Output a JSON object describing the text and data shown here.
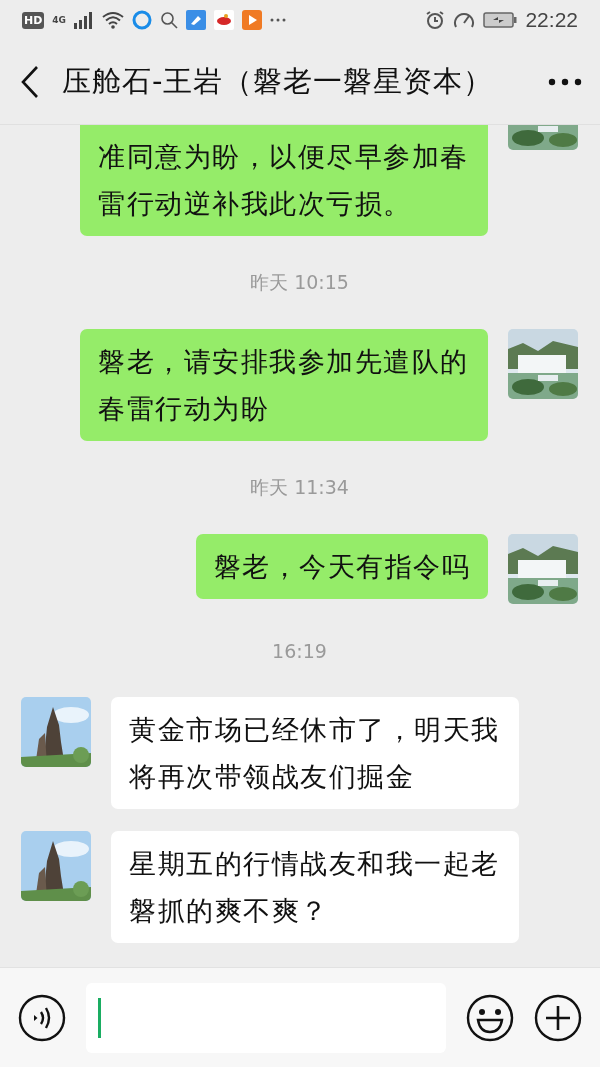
{
  "status_bar": {
    "hd": "HD",
    "network": "4G",
    "time": "22:22"
  },
  "header": {
    "title": "压舱石-王岩（磐老一磐星资本）"
  },
  "messages": [
    {
      "kind": "sent",
      "clipped": true,
      "text": "准同意为盼，以便尽早参加春雷行动逆补我此次亏损。"
    },
    {
      "kind": "time",
      "text": "昨天 10:15"
    },
    {
      "kind": "sent",
      "clipped": false,
      "text": "磐老，请安排我参加先遣队的春雷行动为盼"
    },
    {
      "kind": "time",
      "text": "昨天 11:34"
    },
    {
      "kind": "sent",
      "clipped": false,
      "text": "磐老，今天有指令吗"
    },
    {
      "kind": "time",
      "text": "16:19"
    },
    {
      "kind": "received",
      "clipped": false,
      "text": "黄金市场已经休市了，明天我将再次带领战友们掘金"
    },
    {
      "kind": "received",
      "clipped": false,
      "text": "星期五的行情战友和我一起老磐抓的爽不爽？"
    }
  ]
}
